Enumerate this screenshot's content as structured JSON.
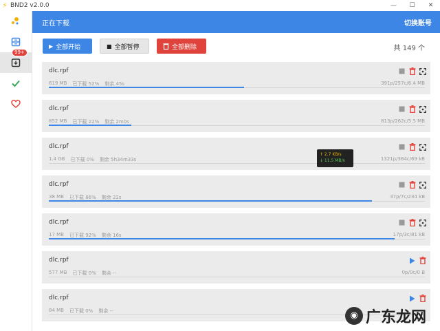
{
  "window": {
    "title": "BND2 v2.0.0",
    "controls": {
      "minimize": "—",
      "maximize": "☐",
      "close": "✕"
    }
  },
  "sidebar": {
    "badge": "99+"
  },
  "header": {
    "title": "正在下载",
    "switch_account": "切换账号"
  },
  "toolbar": {
    "start_all": "全部开始",
    "pause_all": "全部暂停",
    "delete_all": "全部删除",
    "total": "共 149 个"
  },
  "downloads": [
    {
      "name": "dlc.rpf",
      "size": "619 MB",
      "downloaded": "已下载 52%",
      "remaining": "剩余 45s",
      "stats": "391p/257c/6.4 MB",
      "progress": 0.52,
      "state": "downloading"
    },
    {
      "name": "dlc.rpf",
      "size": "852 MB",
      "downloaded": "已下载 22%",
      "remaining": "剩余 2m0s",
      "stats": "813p/262c/5.5 MB",
      "progress": 0.22,
      "state": "downloading"
    },
    {
      "name": "dlc.rpf",
      "size": "1.4 GB",
      "downloaded": "已下载 0%",
      "remaining": "剩余 5h34m33s",
      "stats": "1321p/384c/69 kB",
      "progress": 0.0,
      "state": "downloading"
    },
    {
      "name": "dlc.rpf",
      "size": "38 MB",
      "downloaded": "已下载 86%",
      "remaining": "剩余 22s",
      "stats": "37p/7c/234 kB",
      "progress": 0.86,
      "state": "downloading"
    },
    {
      "name": "dlc.rpf",
      "size": "17 MB",
      "downloaded": "已下载 92%",
      "remaining": "剩余 16s",
      "stats": "17p/3c/81 kB",
      "progress": 0.92,
      "state": "downloading"
    },
    {
      "name": "dlc.rpf",
      "size": "577 MB",
      "downloaded": "已下载 0%",
      "remaining": "剩余 --",
      "stats": "0p/0c/0 B",
      "progress": 0.0,
      "state": "waiting"
    },
    {
      "name": "dlc.rpf",
      "size": "84 MB",
      "downloaded": "已下载 0%",
      "remaining": "剩余 --",
      "stats": "",
      "progress": 0.0,
      "state": "waiting"
    }
  ],
  "speed_tooltip": {
    "upload": "↑ 2.7 KB/s",
    "download": "↓ 11.5 MB/s"
  },
  "watermark": {
    "text": "广东龙网"
  },
  "colors": {
    "accent": "#3d86e6",
    "danger": "#e0433b",
    "done": "#3aa657"
  }
}
